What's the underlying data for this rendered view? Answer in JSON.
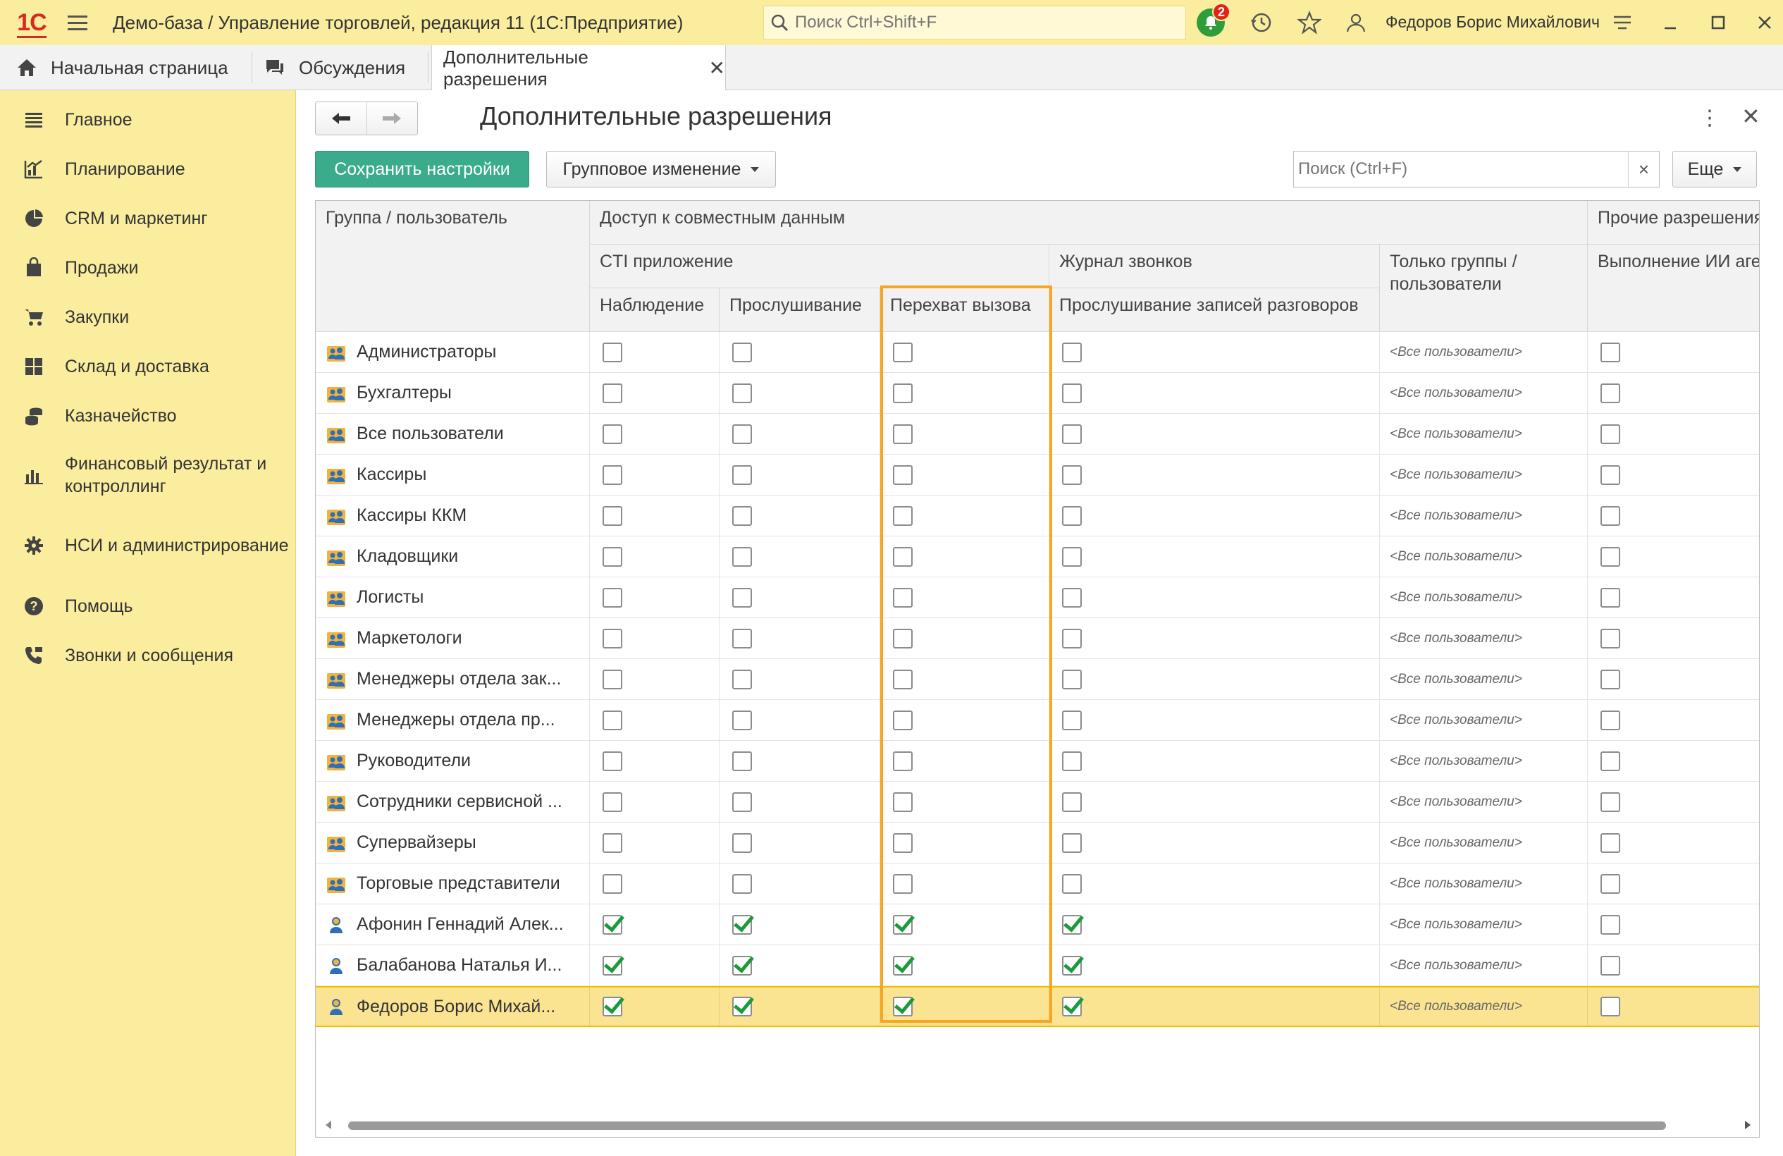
{
  "app": {
    "logo": "1С",
    "title": "Демо-база / Управление торговлей, редакция 11  (1С:Предприятие)",
    "search_placeholder": "Поиск Ctrl+Shift+F",
    "notifications_count": "2",
    "user_name": "Федоров Борис Михайлович"
  },
  "tabs": [
    {
      "label": "Начальная страница",
      "icon": "home-icon"
    },
    {
      "label": "Обсуждения",
      "icon": "chat-icon"
    },
    {
      "label": "Дополнительные разрешения",
      "active": true
    }
  ],
  "sidebar": {
    "items": [
      {
        "label": "Главное",
        "icon": "list-icon"
      },
      {
        "label": "Планирование",
        "icon": "planning-icon"
      },
      {
        "label": "CRM и маркетинг",
        "icon": "pie-chart-icon"
      },
      {
        "label": "Продажи",
        "icon": "bag-icon"
      },
      {
        "label": "Закупки",
        "icon": "cart-icon"
      },
      {
        "label": "Склад и доставка",
        "icon": "warehouse-icon"
      },
      {
        "label": "Казначейство",
        "icon": "coins-icon"
      },
      {
        "label": "Финансовый результат и контроллинг",
        "icon": "bar-chart-icon"
      },
      {
        "label": "НСИ и администрирование",
        "icon": "gear-icon"
      },
      {
        "label": "Помощь",
        "icon": "help-icon"
      },
      {
        "label": "Звонки и сообщения",
        "icon": "phone-icon"
      }
    ]
  },
  "form": {
    "title": "Дополнительные разрешения",
    "save_label": "Сохранить настройки",
    "group_change_label": "Групповое изменение",
    "search_placeholder": "Поиск (Ctrl+F)",
    "more_label": "Еще"
  },
  "table": {
    "headers": {
      "group": "Группа / пользователь",
      "shared_access": "Доступ к совместным данным",
      "other": "Прочие разрешения",
      "cti": "CTI приложение",
      "call_log": "Журнал звонков",
      "only_groups": "Только группы / пользователи",
      "monitoring": "Наблюдение",
      "listening": "Прослушивание",
      "intercept": "Перехват вызова",
      "recordings": "Прослушивание записей разговоров",
      "ai": "Выполнение ИИ агентов"
    },
    "rows": [
      {
        "name": "Администраторы",
        "type": "group",
        "monitoring": false,
        "listening": false,
        "intercept": false,
        "recordings": false,
        "scope": "<Все пользователи>",
        "ai": false
      },
      {
        "name": "Бухгалтеры",
        "type": "group",
        "monitoring": false,
        "listening": false,
        "intercept": false,
        "recordings": false,
        "scope": "<Все пользователи>",
        "ai": false
      },
      {
        "name": "Все пользователи",
        "type": "group",
        "monitoring": false,
        "listening": false,
        "intercept": false,
        "recordings": false,
        "scope": "<Все пользователи>",
        "ai": false
      },
      {
        "name": "Кассиры",
        "type": "group",
        "monitoring": false,
        "listening": false,
        "intercept": false,
        "recordings": false,
        "scope": "<Все пользователи>",
        "ai": false
      },
      {
        "name": "Кассиры ККМ",
        "type": "group",
        "monitoring": false,
        "listening": false,
        "intercept": false,
        "recordings": false,
        "scope": "<Все пользователи>",
        "ai": false
      },
      {
        "name": "Кладовщики",
        "type": "group",
        "monitoring": false,
        "listening": false,
        "intercept": false,
        "recordings": false,
        "scope": "<Все пользователи>",
        "ai": false
      },
      {
        "name": "Логисты",
        "type": "group",
        "monitoring": false,
        "listening": false,
        "intercept": false,
        "recordings": false,
        "scope": "<Все пользователи>",
        "ai": false
      },
      {
        "name": "Маркетологи",
        "type": "group",
        "monitoring": false,
        "listening": false,
        "intercept": false,
        "recordings": false,
        "scope": "<Все пользователи>",
        "ai": false
      },
      {
        "name": "Менеджеры отдела зак...",
        "type": "group",
        "monitoring": false,
        "listening": false,
        "intercept": false,
        "recordings": false,
        "scope": "<Все пользователи>",
        "ai": false
      },
      {
        "name": "Менеджеры отдела пр...",
        "type": "group",
        "monitoring": false,
        "listening": false,
        "intercept": false,
        "recordings": false,
        "scope": "<Все пользователи>",
        "ai": false
      },
      {
        "name": "Руководители",
        "type": "group",
        "monitoring": false,
        "listening": false,
        "intercept": false,
        "recordings": false,
        "scope": "<Все пользователи>",
        "ai": false
      },
      {
        "name": "Сотрудники сервисной ...",
        "type": "group",
        "monitoring": false,
        "listening": false,
        "intercept": false,
        "recordings": false,
        "scope": "<Все пользователи>",
        "ai": false
      },
      {
        "name": "Супервайзеры",
        "type": "group",
        "monitoring": false,
        "listening": false,
        "intercept": false,
        "recordings": false,
        "scope": "<Все пользователи>",
        "ai": false
      },
      {
        "name": "Торговые представители",
        "type": "group",
        "monitoring": false,
        "listening": false,
        "intercept": false,
        "recordings": false,
        "scope": "<Все пользователи>",
        "ai": false
      },
      {
        "name": "Афонин Геннадий Алек...",
        "type": "user",
        "monitoring": true,
        "listening": true,
        "intercept": true,
        "recordings": true,
        "scope": "<Все пользователи>",
        "ai": false
      },
      {
        "name": "Балабанова Наталья И...",
        "type": "user",
        "monitoring": true,
        "listening": true,
        "intercept": true,
        "recordings": true,
        "scope": "<Все пользователи>",
        "ai": false
      },
      {
        "name": "Федоров Борис Михай...",
        "type": "user",
        "monitoring": true,
        "listening": true,
        "intercept": true,
        "recordings": true,
        "scope": "<Все пользователи>",
        "ai": false,
        "selected": true
      }
    ]
  },
  "colors": {
    "accent_yellow": "#fbed9e",
    "save_green": "#3aab8b",
    "highlight_orange": "#f5a623",
    "check_green": "#1b9a3c"
  }
}
